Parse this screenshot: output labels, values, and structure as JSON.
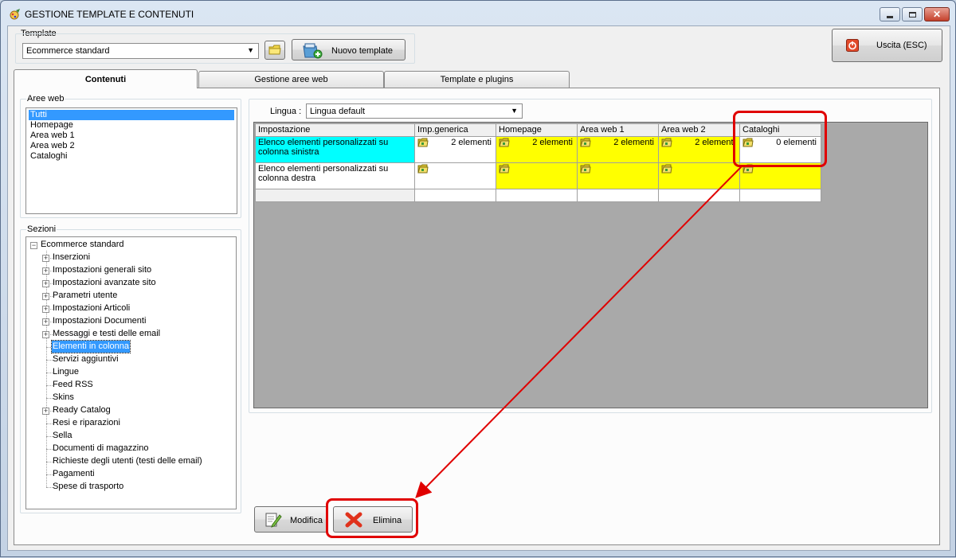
{
  "window": {
    "title": "GESTIONE TEMPLATE E CONTENUTI"
  },
  "template": {
    "label": "Template",
    "selected": "Ecommerce standard",
    "new_button": "Nuovo template"
  },
  "exit_button": "Uscita (ESC)",
  "tabs": [
    "Contenuti",
    "Gestione aree web",
    "Template e plugins"
  ],
  "aree_web": {
    "label": "Aree web",
    "items": [
      "Tutti",
      "Homepage",
      "Area web 1",
      "Area web 2",
      "Cataloghi"
    ]
  },
  "sezioni": {
    "label": "Sezioni",
    "root": "Ecommerce standard",
    "items": [
      "Inserzioni",
      "Impostazioni generali sito",
      "Impostazioni avanzate sito",
      "Parametri utente",
      "Impostazioni Articoli",
      "Impostazioni Documenti",
      "Messaggi e testi delle email",
      "Elementi in colonna",
      "Servizi aggiuntivi",
      "Lingue",
      "Feed RSS",
      "Skins",
      "Ready Catalog",
      "Resi e riparazioni",
      "Sella",
      "Documenti di magazzino",
      "Richieste degli utenti (testi delle email)",
      "Pagamenti",
      "Spese di trasporto"
    ]
  },
  "lingua": {
    "label": "Lingua :",
    "selected": "Lingua default"
  },
  "grid": {
    "headers": [
      "Impostazione",
      "Imp.generica",
      "Homepage",
      "Area web 1",
      "Area web 2",
      "Cataloghi"
    ],
    "rows": [
      {
        "name": "Elenco elementi personalizzati su colonna sinistra",
        "values": [
          "2 elementi",
          "2 elementi",
          "2 elementi",
          "2 elementi",
          "0 elementi"
        ]
      },
      {
        "name": "Elenco elementi personalizzati su colonna destra",
        "values": [
          "",
          "",
          "",
          "",
          ""
        ]
      }
    ]
  },
  "buttons": {
    "modifica": "Modifica",
    "elimina": "Elimina"
  },
  "colors": {
    "selection": "#3399ff",
    "cyan": "#00ffff",
    "yellow": "#ffff00",
    "annotation_red": "#e00000",
    "grid_bg": "#a9a9a9"
  }
}
